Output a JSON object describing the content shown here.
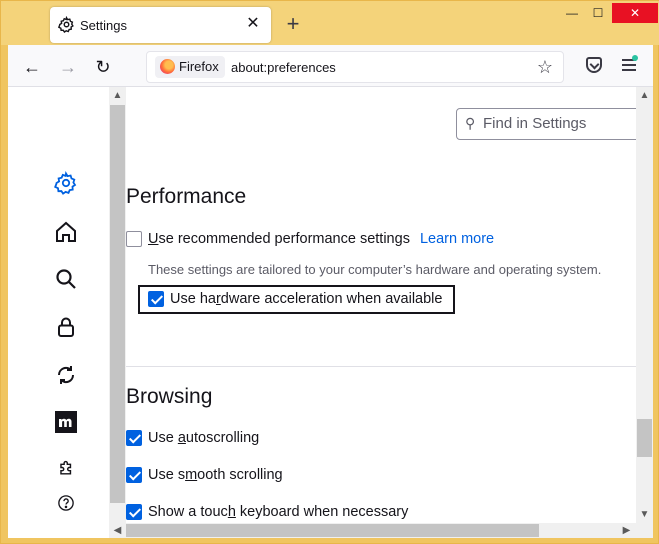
{
  "tab": {
    "title": "Settings",
    "icon": "gear-icon",
    "close": "✕"
  },
  "new_tab": "+",
  "window_controls": {
    "minimize": "—",
    "maximize": "☐",
    "close": "✕"
  },
  "toolbar": {
    "back": "←",
    "forward": "→",
    "reload": "↻",
    "identity_label": "Firefox",
    "url": "about:preferences",
    "bookmark_star": "☆"
  },
  "search": {
    "placeholder": "Find in Settings"
  },
  "sidebar": {
    "items": [
      {
        "name": "general",
        "icon": "gear-icon"
      },
      {
        "name": "home",
        "icon": "home-icon"
      },
      {
        "name": "search",
        "icon": "search-icon"
      },
      {
        "name": "privacy",
        "icon": "lock-icon"
      },
      {
        "name": "sync",
        "icon": "sync-icon"
      },
      {
        "name": "more-from-mozilla",
        "icon": "mozilla-m-icon"
      },
      {
        "name": "extensions",
        "icon": "puzzle-icon"
      },
      {
        "name": "support",
        "icon": "help-icon"
      }
    ]
  },
  "performance": {
    "title": "Performance",
    "recommended": {
      "pre": "",
      "ul": "U",
      "post": "se recommended performance settings",
      "checked": false
    },
    "learn_more": "Learn more",
    "description": "These settings are tailored to your computer’s hardware and operating system.",
    "hardware": {
      "pre": "Use ha",
      "ul": "r",
      "post": "dware acceleration when available",
      "checked": true
    }
  },
  "browsing": {
    "title": "Browsing",
    "autoscroll": {
      "pre": "Use ",
      "ul": "a",
      "post": "utoscrolling",
      "checked": true
    },
    "smooth": {
      "pre": "Use s",
      "ul": "m",
      "post": "ooth scrolling",
      "checked": true
    },
    "touch_keyboard": {
      "pre": "Show a touc",
      "ul": "h",
      "post": " keyboard when necessary",
      "checked": true
    }
  },
  "colors": {
    "accent": "#0061e0",
    "frame": "#f0c560"
  }
}
